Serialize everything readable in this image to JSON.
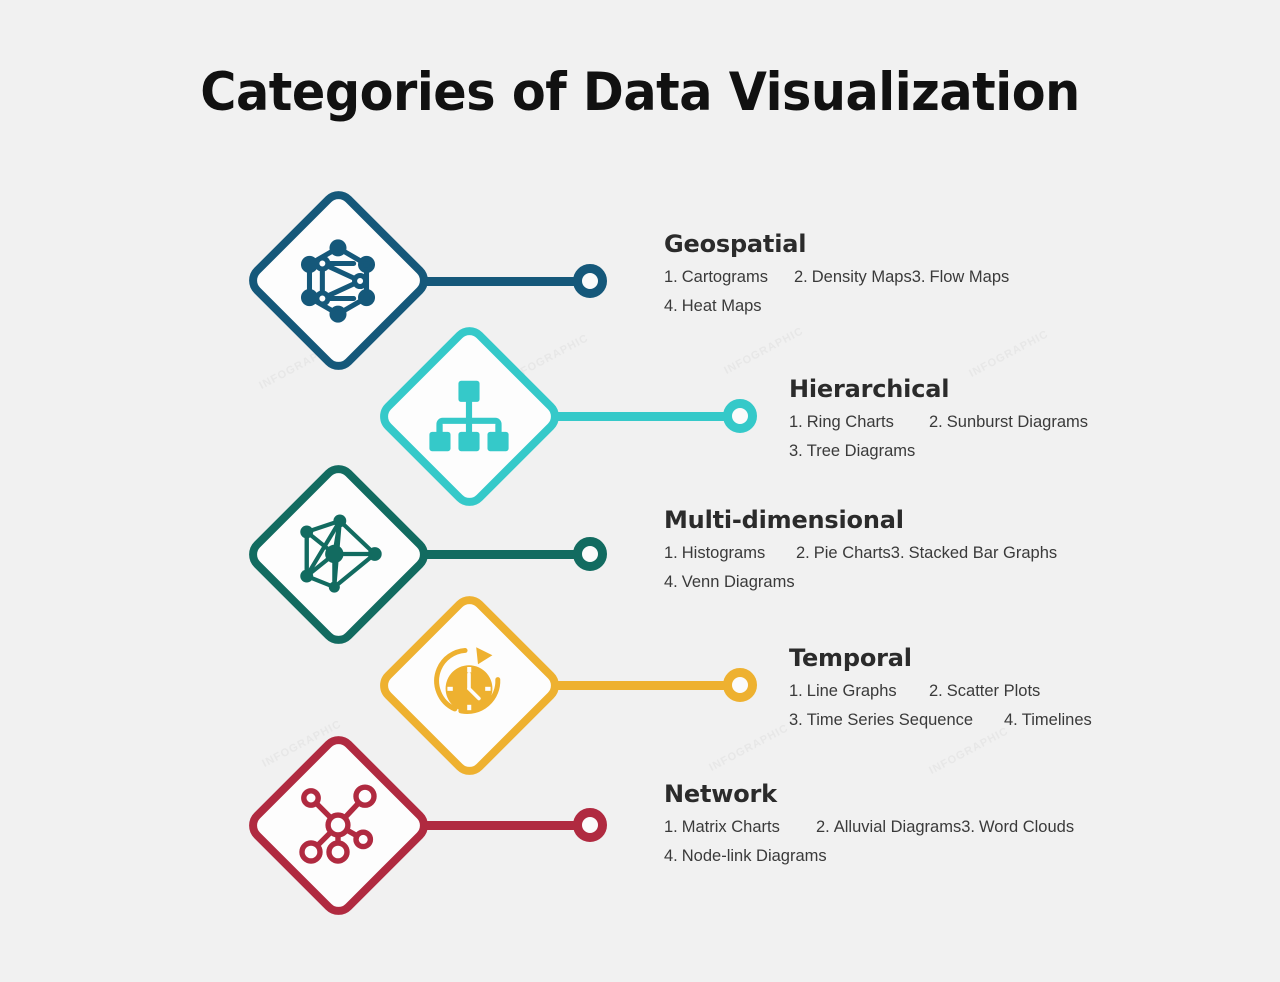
{
  "page": {
    "title": "Categories of Data Visualization",
    "background_color": "#f1f1f1",
    "watermark_text": "INFOGRAPHIC"
  },
  "categories": [
    {
      "id": "geospatial",
      "name": "Geospatial",
      "color": "#15587a",
      "icon": "network-hexagon-icon",
      "items": [
        {
          "num": "1.",
          "label": "Cartograms"
        },
        {
          "num": "2.",
          "label": "Density Maps"
        },
        {
          "num": "3.",
          "label": "Flow Maps"
        },
        {
          "num": "4.",
          "label": "Heat Maps"
        }
      ]
    },
    {
      "id": "hierarchical",
      "name": "Hierarchical",
      "color": "#35c9c9",
      "icon": "org-chart-tree-icon",
      "items": [
        {
          "num": "1.",
          "label": "Ring Charts"
        },
        {
          "num": "2.",
          "label": "Sunburst Diagrams"
        },
        {
          "num": "3.",
          "label": "Tree Diagrams"
        }
      ]
    },
    {
      "id": "multi-dimensional",
      "name": "Multi-dimensional",
      "color": "#126b60",
      "icon": "node-graph-icon",
      "items": [
        {
          "num": "1.",
          "label": "Histograms"
        },
        {
          "num": "2.",
          "label": "Pie Charts"
        },
        {
          "num": "3.",
          "label": "Stacked Bar Graphs"
        },
        {
          "num": "4.",
          "label": "Venn Diagrams"
        }
      ]
    },
    {
      "id": "temporal",
      "name": "Temporal",
      "color": "#eeb130",
      "icon": "clock-arrow-icon",
      "items": [
        {
          "num": "1.",
          "label": "Line Graphs"
        },
        {
          "num": "2.",
          "label": "Scatter Plots"
        },
        {
          "num": "3.",
          "label": "Time Series Sequence"
        },
        {
          "num": "4.",
          "label": "Timelines"
        }
      ]
    },
    {
      "id": "network",
      "name": "Network",
      "color": "#b02a40",
      "icon": "hub-spoke-icon",
      "items": [
        {
          "num": "1.",
          "label": "Matrix Charts"
        },
        {
          "num": "2.",
          "label": "Alluvial Diagrams"
        },
        {
          "num": "3.",
          "label": "Word Clouds"
        },
        {
          "num": "4.",
          "label": "Node-link Diagrams"
        }
      ]
    }
  ]
}
